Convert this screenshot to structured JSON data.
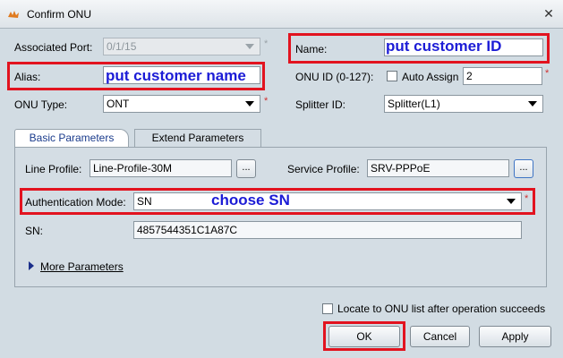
{
  "window": {
    "title": "Confirm ONU",
    "close_glyph": "✕"
  },
  "form": {
    "associated_port": {
      "label": "Associated Port:",
      "value": "0/1/15"
    },
    "alias": {
      "label": "Alias:",
      "value": "",
      "annotation": "put customer name"
    },
    "onu_type": {
      "label": "ONU Type:",
      "value": "ONT"
    },
    "name": {
      "label": "Name:",
      "value": "",
      "annotation": "put customer ID"
    },
    "onu_id": {
      "label": "ONU ID (0-127):",
      "value": "2",
      "auto_assign_label": "Auto Assign",
      "auto_assign_checked": false
    },
    "splitter_id": {
      "label": "Splitter ID:",
      "value": "Splitter(L1)"
    },
    "required_mark": "*"
  },
  "tabs": [
    {
      "label": "Basic Parameters",
      "active": true
    },
    {
      "label": "Extend Parameters",
      "active": false
    }
  ],
  "basic": {
    "line_profile": {
      "label": "Line Profile:",
      "value": "Line-Profile-30M",
      "button": "..."
    },
    "service_profile": {
      "label": "Service Profile:",
      "value": "SRV-PPPoE",
      "button": "..."
    },
    "auth_mode": {
      "label": "Authentication Mode:",
      "value": "SN",
      "annotation": "choose SN"
    },
    "sn": {
      "label": "SN:",
      "value": "4857544351C1A87C"
    },
    "more_params": "More Parameters"
  },
  "footer": {
    "locate_label": "Locate to ONU list after operation succeeds",
    "locate_checked": false,
    "ok": "OK",
    "cancel": "Cancel",
    "apply": "Apply"
  },
  "colors": {
    "highlight": "#e2131f",
    "annotation_text": "#1c1cd6",
    "background": "#d2dce3"
  }
}
